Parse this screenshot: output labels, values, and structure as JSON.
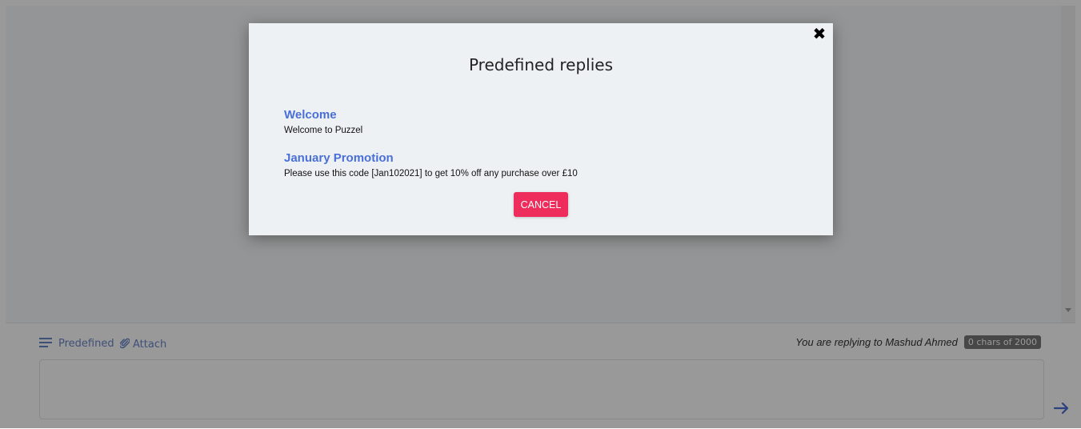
{
  "composer": {
    "predefined_label": "Predefined",
    "attach_label": "Attach",
    "reply_info": "You are replying to Mashud Ahmed",
    "char_count": "0 chars of 2000"
  },
  "modal": {
    "title": "Predefined replies",
    "close_symbol": "✖",
    "replies": [
      {
        "title": "Welcome",
        "body": "Welcome to Puzzel"
      },
      {
        "title": "January Promotion",
        "body": "Please use this code [Jan102021] to get 10% off any purchase over £10"
      }
    ],
    "cancel_label": "CANCEL"
  },
  "colors": {
    "accent": "#4a6fd6",
    "cancel": "#ee2d5c",
    "overlay": "rgba(0,0,0,0.40)"
  },
  "icons": [
    "list-icon",
    "paperclip-icon",
    "send-arrow-icon",
    "close-icon"
  ]
}
